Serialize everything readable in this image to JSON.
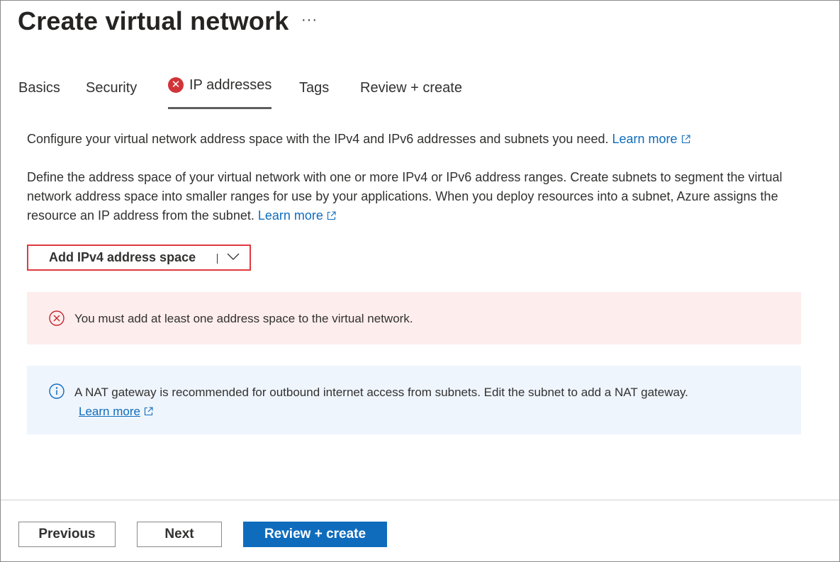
{
  "header": {
    "title": "Create virtual network",
    "more_label": "···"
  },
  "tabs": [
    {
      "label": "Basics",
      "active": false,
      "error": false
    },
    {
      "label": "Security",
      "active": false,
      "error": false
    },
    {
      "label": "IP addresses",
      "active": true,
      "error": true
    },
    {
      "label": "Tags",
      "active": false,
      "error": false
    },
    {
      "label": "Review + create",
      "active": false,
      "error": false
    }
  ],
  "icons": {
    "tab_error": "error-x-circle-icon",
    "external_link": "external-link-icon",
    "chevron": "chevron-down-icon",
    "error_banner": "error-circle-outline-icon",
    "info_banner": "info-circle-icon"
  },
  "intro": {
    "text": "Configure your virtual network address space with the IPv4 and IPv6 addresses and subnets you need.",
    "link": "Learn more"
  },
  "description": {
    "text": "Define the address space of your virtual network with one or more IPv4 or IPv6 address ranges. Create subnets to segment the virtual network address space into smaller ranges for use by your applications. When you deploy resources into a subnet, Azure assigns the resource an IP address from the subnet.",
    "link": "Learn more"
  },
  "add_space_button": {
    "label": "Add IPv4 address space"
  },
  "error_banner": {
    "text": "You must add at least one address space to the virtual network."
  },
  "info_banner": {
    "text": "A NAT gateway is recommended for outbound internet access from subnets. Edit the subnet to add a NAT gateway.",
    "link": "Learn more"
  },
  "footer": {
    "previous_label": "Previous",
    "next_label": "Next",
    "review_label": "Review + create"
  },
  "colors": {
    "accent": "#0f6cbd",
    "error": "#d13438",
    "error_bg": "#fdeded",
    "info_bg": "#eff5fd",
    "highlight_border": "#e0393e"
  }
}
